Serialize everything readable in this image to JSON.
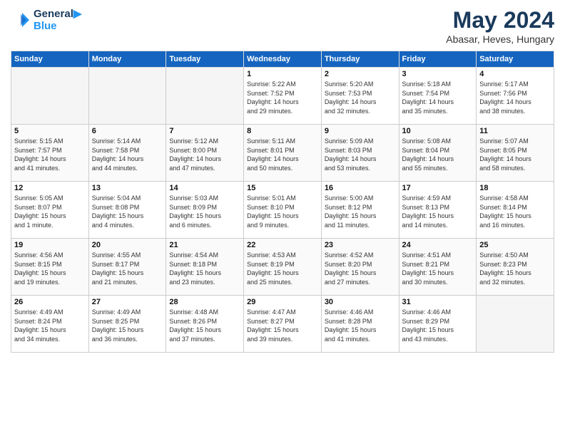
{
  "header": {
    "logo_line1": "General",
    "logo_line2": "Blue",
    "month": "May 2024",
    "location": "Abasar, Heves, Hungary"
  },
  "weekdays": [
    "Sunday",
    "Monday",
    "Tuesday",
    "Wednesday",
    "Thursday",
    "Friday",
    "Saturday"
  ],
  "weeks": [
    [
      {
        "day": "",
        "info": ""
      },
      {
        "day": "",
        "info": ""
      },
      {
        "day": "",
        "info": ""
      },
      {
        "day": "1",
        "info": "Sunrise: 5:22 AM\nSunset: 7:52 PM\nDaylight: 14 hours\nand 29 minutes."
      },
      {
        "day": "2",
        "info": "Sunrise: 5:20 AM\nSunset: 7:53 PM\nDaylight: 14 hours\nand 32 minutes."
      },
      {
        "day": "3",
        "info": "Sunrise: 5:18 AM\nSunset: 7:54 PM\nDaylight: 14 hours\nand 35 minutes."
      },
      {
        "day": "4",
        "info": "Sunrise: 5:17 AM\nSunset: 7:56 PM\nDaylight: 14 hours\nand 38 minutes."
      }
    ],
    [
      {
        "day": "5",
        "info": "Sunrise: 5:15 AM\nSunset: 7:57 PM\nDaylight: 14 hours\nand 41 minutes."
      },
      {
        "day": "6",
        "info": "Sunrise: 5:14 AM\nSunset: 7:58 PM\nDaylight: 14 hours\nand 44 minutes."
      },
      {
        "day": "7",
        "info": "Sunrise: 5:12 AM\nSunset: 8:00 PM\nDaylight: 14 hours\nand 47 minutes."
      },
      {
        "day": "8",
        "info": "Sunrise: 5:11 AM\nSunset: 8:01 PM\nDaylight: 14 hours\nand 50 minutes."
      },
      {
        "day": "9",
        "info": "Sunrise: 5:09 AM\nSunset: 8:03 PM\nDaylight: 14 hours\nand 53 minutes."
      },
      {
        "day": "10",
        "info": "Sunrise: 5:08 AM\nSunset: 8:04 PM\nDaylight: 14 hours\nand 55 minutes."
      },
      {
        "day": "11",
        "info": "Sunrise: 5:07 AM\nSunset: 8:05 PM\nDaylight: 14 hours\nand 58 minutes."
      }
    ],
    [
      {
        "day": "12",
        "info": "Sunrise: 5:05 AM\nSunset: 8:07 PM\nDaylight: 15 hours\nand 1 minute."
      },
      {
        "day": "13",
        "info": "Sunrise: 5:04 AM\nSunset: 8:08 PM\nDaylight: 15 hours\nand 4 minutes."
      },
      {
        "day": "14",
        "info": "Sunrise: 5:03 AM\nSunset: 8:09 PM\nDaylight: 15 hours\nand 6 minutes."
      },
      {
        "day": "15",
        "info": "Sunrise: 5:01 AM\nSunset: 8:10 PM\nDaylight: 15 hours\nand 9 minutes."
      },
      {
        "day": "16",
        "info": "Sunrise: 5:00 AM\nSunset: 8:12 PM\nDaylight: 15 hours\nand 11 minutes."
      },
      {
        "day": "17",
        "info": "Sunrise: 4:59 AM\nSunset: 8:13 PM\nDaylight: 15 hours\nand 14 minutes."
      },
      {
        "day": "18",
        "info": "Sunrise: 4:58 AM\nSunset: 8:14 PM\nDaylight: 15 hours\nand 16 minutes."
      }
    ],
    [
      {
        "day": "19",
        "info": "Sunrise: 4:56 AM\nSunset: 8:15 PM\nDaylight: 15 hours\nand 19 minutes."
      },
      {
        "day": "20",
        "info": "Sunrise: 4:55 AM\nSunset: 8:17 PM\nDaylight: 15 hours\nand 21 minutes."
      },
      {
        "day": "21",
        "info": "Sunrise: 4:54 AM\nSunset: 8:18 PM\nDaylight: 15 hours\nand 23 minutes."
      },
      {
        "day": "22",
        "info": "Sunrise: 4:53 AM\nSunset: 8:19 PM\nDaylight: 15 hours\nand 25 minutes."
      },
      {
        "day": "23",
        "info": "Sunrise: 4:52 AM\nSunset: 8:20 PM\nDaylight: 15 hours\nand 27 minutes."
      },
      {
        "day": "24",
        "info": "Sunrise: 4:51 AM\nSunset: 8:21 PM\nDaylight: 15 hours\nand 30 minutes."
      },
      {
        "day": "25",
        "info": "Sunrise: 4:50 AM\nSunset: 8:23 PM\nDaylight: 15 hours\nand 32 minutes."
      }
    ],
    [
      {
        "day": "26",
        "info": "Sunrise: 4:49 AM\nSunset: 8:24 PM\nDaylight: 15 hours\nand 34 minutes."
      },
      {
        "day": "27",
        "info": "Sunrise: 4:49 AM\nSunset: 8:25 PM\nDaylight: 15 hours\nand 36 minutes."
      },
      {
        "day": "28",
        "info": "Sunrise: 4:48 AM\nSunset: 8:26 PM\nDaylight: 15 hours\nand 37 minutes."
      },
      {
        "day": "29",
        "info": "Sunrise: 4:47 AM\nSunset: 8:27 PM\nDaylight: 15 hours\nand 39 minutes."
      },
      {
        "day": "30",
        "info": "Sunrise: 4:46 AM\nSunset: 8:28 PM\nDaylight: 15 hours\nand 41 minutes."
      },
      {
        "day": "31",
        "info": "Sunrise: 4:46 AM\nSunset: 8:29 PM\nDaylight: 15 hours\nand 43 minutes."
      },
      {
        "day": "",
        "info": ""
      }
    ]
  ]
}
